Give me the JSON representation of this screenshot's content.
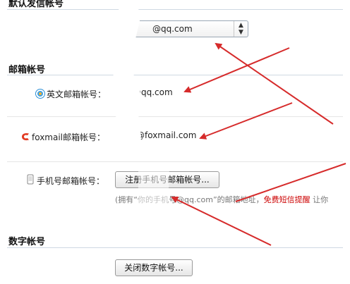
{
  "default_sender": {
    "title": "默认发信帐号",
    "selected_value": "@qq.com"
  },
  "mail_accounts": {
    "title": "邮箱帐号",
    "english": {
      "label": "英文邮箱帐号：",
      "value": "@qq.com"
    },
    "foxmail": {
      "label": "foxmail邮箱帐号：",
      "value": "@foxmail.com"
    },
    "mobile": {
      "label": "手机号邮箱帐号：",
      "button": "注册手机号邮箱帐号...",
      "hint_before": "(拥有“你的手机号@qq.com”的邮箱地址，",
      "hint_red": "免费短信提醒",
      "hint_after": " 让你"
    }
  },
  "digital_account": {
    "title": "数字帐号",
    "button": "关闭数字帐号..."
  },
  "colors": {
    "arrow": "#d62b2b",
    "accent_red": "#cc0000"
  },
  "icons": [
    "qq-penguin-icon",
    "foxmail-icon",
    "mobile-phone-icon",
    "select-arrows-icon"
  ]
}
